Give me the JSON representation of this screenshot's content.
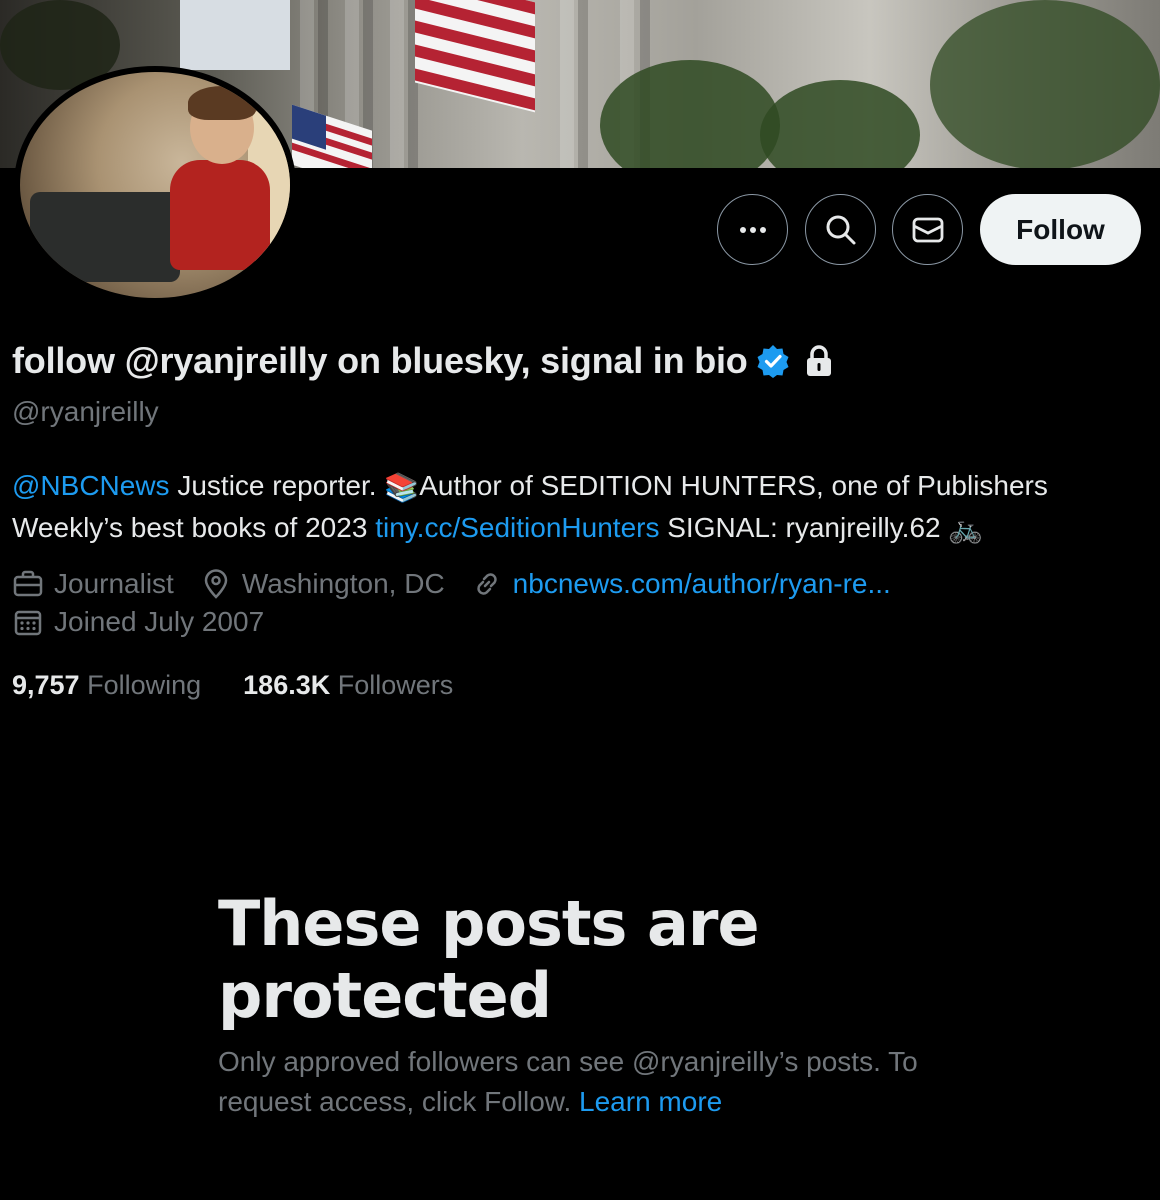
{
  "profile": {
    "display_name": "follow @ryanjreilly on bluesky, signal in bio",
    "handle": "@ryanjreilly",
    "verified": true,
    "protected": true
  },
  "actions": {
    "more_label": "More",
    "search_label": "Search",
    "message_label": "Message",
    "follow_label": "Follow"
  },
  "bio": {
    "mention": "@NBCNews",
    "text1": " Justice reporter. ",
    "emoji_books": "📚",
    "text2": "Author of SEDITION HUNTERS, one of Publishers Weekly’s best books of 2023 ",
    "link": "tiny.cc/SeditionHunters",
    "text3": " SIGNAL: ryanjreilly.62 ",
    "emoji_bike": "🚲"
  },
  "meta": {
    "profession": "Journalist",
    "location": "Washington, DC",
    "website": "nbcnews.com/author/ryan-re...",
    "joined": "Joined July 2007"
  },
  "stats": {
    "following_count": "9,757",
    "following_label": "Following",
    "followers_count": "186.3K",
    "followers_label": "Followers"
  },
  "protected_notice": {
    "title": "These posts are protected",
    "body": "Only approved followers can see @ryanjreilly’s posts. To request access, click Follow.",
    "learn_more": "Learn more"
  },
  "colors": {
    "background": "#000000",
    "text_primary": "#e7e9ea",
    "text_secondary": "#71767b",
    "link": "#1d9bf0",
    "verified": "#1d9bf0",
    "follow_button_bg": "#eff3f4"
  }
}
